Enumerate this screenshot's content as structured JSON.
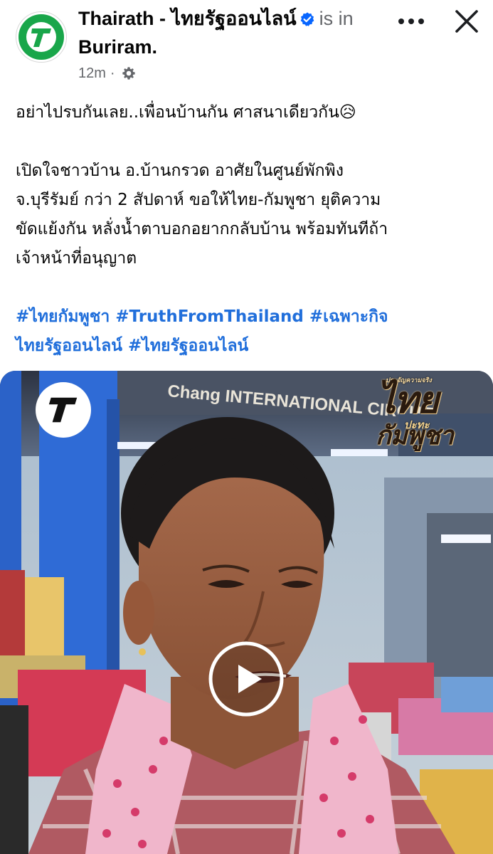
{
  "header": {
    "page_name": "Thairath - ไทยรัฐออนไลน์",
    "location_prefix": "is in",
    "location": "Buriram.",
    "timestamp": "12m",
    "separator": "·",
    "icons": {
      "avatar": "thairath-logo",
      "verified": "verified-badge-icon",
      "audience": "gear-icon",
      "more": "more-horizontal-icon",
      "close": "close-icon"
    }
  },
  "post": {
    "line1": "อย่าไปรบกันเลย..เพื่อนบ้านกัน ศาสนาเดียวกัน😥",
    "paragraph_lines": [
      "เปิดใจชาวบ้าน อ.บ้านกรวด อาศัยในศูนย์พักพิง",
      "จ.บุรีรัมย์ กว่า 2 สัปดาห์ ขอให้ไทย-กัมพูชา ยุติความ",
      "ขัดแย้งกัน หลั่งน้ำตาบอกอยากกลับบ้าน พร้อมทันทีถ้า",
      "เจ้าหน้าที่อนุญาต"
    ],
    "hashtags_line1": [
      "#ไทยกัมพูชา",
      "#TruthFromThailand",
      "#เฉพาะกิจ"
    ],
    "hashtags_line2": [
      "ไทยรัฐออนไลน์",
      "#ไทยรัฐออนไลน์"
    ]
  },
  "video": {
    "banner_text": "Chang INTERNATIONAL CIRCUIT",
    "stamp_top": "ประจัญความจริง",
    "stamp_main": "ไทย",
    "stamp_mid": "ปะทะ",
    "stamp_bottom": "กัมพูชา",
    "play_icon": "play-icon"
  },
  "colors": {
    "brand_green": "#19a64a",
    "verified_blue": "#0866ff",
    "link_blue": "#216fdb",
    "secondary_text": "#65676b"
  }
}
